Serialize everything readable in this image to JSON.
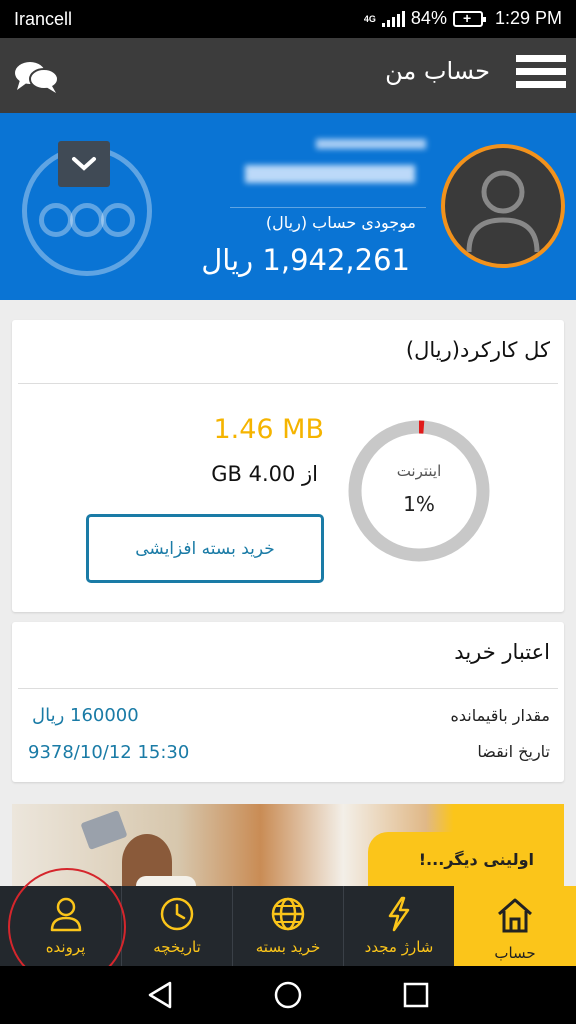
{
  "status": {
    "carrier": "Irancell",
    "network": "4G",
    "battery": "84%",
    "time": "1:29 PM"
  },
  "header": {
    "title": "حساب من"
  },
  "account": {
    "balance_label": "موجودی حساب (ریال)",
    "balance_value": "1,942,261 ریال",
    "accent_color": "#0a74d4",
    "avatar_ring_color": "#f2921c"
  },
  "usage": {
    "title": "کل کارکرد(ریال)",
    "gauge_label": "اینترنت",
    "gauge_percent_text": "1%",
    "gauge_fraction": 0.01,
    "used": "1.46 MB",
    "total": "از 4.00 GB",
    "buy_button": "خرید بسته افزایشی"
  },
  "purchase_credit": {
    "title": "اعتبار خرید",
    "rows": [
      {
        "label": "مقدار باقیمانده",
        "value": "160000 ریال"
      },
      {
        "label": "تاریخ انقضا",
        "value": "9378/10/12 15:30"
      }
    ]
  },
  "banner": {
    "text": "اولینی دیگر...!"
  },
  "tabs": [
    {
      "label": "حساب",
      "icon": "home-icon",
      "active": true
    },
    {
      "label": "شارژ مجدد",
      "icon": "lightning-icon",
      "active": false
    },
    {
      "label": "خرید بسته",
      "icon": "globe-icon",
      "active": false
    },
    {
      "label": "تاریخچه",
      "icon": "clock-icon",
      "active": false
    },
    {
      "label": "پرونده",
      "icon": "person-icon",
      "active": false
    }
  ],
  "colors": {
    "tab_active": "#fbc51a",
    "tab_bg": "#23282d",
    "link": "#1a7ba6",
    "used_value": "#f5b400"
  }
}
